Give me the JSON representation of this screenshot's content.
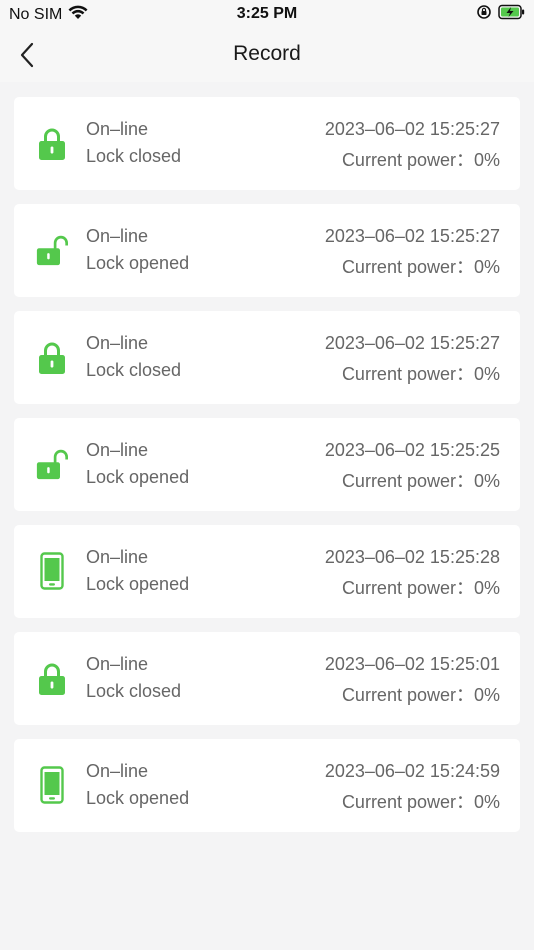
{
  "status_bar": {
    "carrier": "No SIM",
    "time": "3:25 PM"
  },
  "header": {
    "title": "Record"
  },
  "colors": {
    "accent": "#54c84c",
    "card": "#ffffff",
    "background": "#f4f4f5",
    "text": "#666666"
  },
  "records": [
    {
      "icon": "lock-closed-icon",
      "status": "On–line",
      "action": "Lock closed",
      "time": "2023–06–02 15:25:27",
      "power": "Current power：0%"
    },
    {
      "icon": "lock-open-icon",
      "status": "On–line",
      "action": "Lock opened",
      "time": "2023–06–02 15:25:27",
      "power": "Current power：0%"
    },
    {
      "icon": "lock-closed-icon",
      "status": "On–line",
      "action": "Lock closed",
      "time": "2023–06–02 15:25:27",
      "power": "Current power：0%"
    },
    {
      "icon": "lock-open-icon",
      "status": "On–line",
      "action": "Lock opened",
      "time": "2023–06–02 15:25:25",
      "power": "Current power：0%"
    },
    {
      "icon": "phone-icon",
      "status": "On–line",
      "action": "Lock opened",
      "time": "2023–06–02 15:25:28",
      "power": "Current power：0%"
    },
    {
      "icon": "lock-closed-icon",
      "status": "On–line",
      "action": "Lock closed",
      "time": "2023–06–02 15:25:01",
      "power": "Current power：0%"
    },
    {
      "icon": "phone-icon",
      "status": "On–line",
      "action": "Lock opened",
      "time": "2023–06–02 15:24:59",
      "power": "Current power：0%"
    }
  ]
}
